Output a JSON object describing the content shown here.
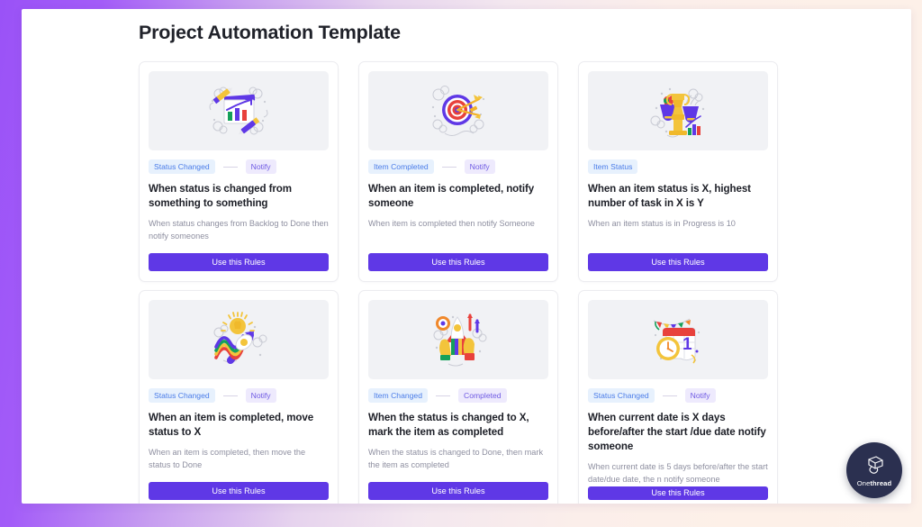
{
  "page": {
    "title": "Project Automation Template"
  },
  "brand": {
    "name_light": "One",
    "name_bold": "thread",
    "icon": "onethread-cube-icon",
    "circle_color": "#2b3050"
  },
  "theme": {
    "frame_gradient_start": "#9a52f7",
    "frame_gradient_end": "#fdf1e9",
    "button_color": "#5f38e6",
    "pill_blue_bg": "#e7f1fd",
    "pill_blue_text": "#4a7ce8",
    "pill_purple_bg": "#eeeafd",
    "pill_purple_text": "#6f5ae3",
    "illustration_bg": "#f1f2f5",
    "card_border": "#ececf0"
  },
  "cards": [
    {
      "illustration": "chart-document-pencils-illustration",
      "trigger_tag": "Status Changed",
      "action_tag": "Notify",
      "has_action_tag": true,
      "title": "When status is changed from something to something",
      "description": "When status changes from Backlog to Done then notify someones",
      "button_label": "Use this Rules"
    },
    {
      "illustration": "target-arrows-illustration",
      "trigger_tag": "Item Completed",
      "action_tag": "Notify",
      "has_action_tag": true,
      "title": "When an item is completed, notify someone",
      "description": "When item is completed then notify Someone",
      "button_label": "Use this Rules"
    },
    {
      "illustration": "trophy-award-illustration",
      "trigger_tag": "Item Status",
      "action_tag": "",
      "has_action_tag": false,
      "title": "When an item status is X, highest number of task in X is Y",
      "description": "When an item status is in Progress is 10",
      "button_label": "Use this Rules"
    },
    {
      "illustration": "rocket-rainbow-lightbulb-illustration",
      "trigger_tag": "Status Changed",
      "action_tag": "Notify",
      "has_action_tag": true,
      "title": "When an item is completed, move status to X",
      "description": "When an item is completed, then move the status to Done",
      "button_label": "Use this Rules"
    },
    {
      "illustration": "rocket-launch-hands-illustration",
      "trigger_tag": "Item Changed",
      "action_tag": "Completed",
      "has_action_tag": true,
      "title": "When the status is changed to X, mark the item as completed",
      "description": "When the status is changed to Done, then mark the item as completed",
      "button_label": "Use this Rules"
    },
    {
      "illustration": "calendar-clock-celebration-illustration",
      "trigger_tag": "Status Changed",
      "action_tag": "Notify",
      "has_action_tag": true,
      "title": "When current date is X days before/after the start /due date notify someone",
      "description": "When current date is 5 days before/after the start date/due date, the n notify someone",
      "button_label": "Use this Rules"
    }
  ]
}
